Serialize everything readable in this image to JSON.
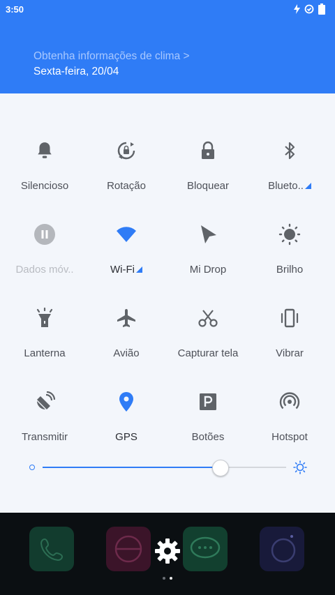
{
  "status_bar": {
    "time": "3:50"
  },
  "header": {
    "weather_link": "Obtenha informações de clima >",
    "date": "Sexta-feira, 20/04"
  },
  "tiles": [
    {
      "label": "Silencioso",
      "icon": "bell-icon"
    },
    {
      "label": "Rotação",
      "icon": "rotation-lock-icon"
    },
    {
      "label": "Bloquear",
      "icon": "lock-icon"
    },
    {
      "label": "Blueto..",
      "icon": "bluetooth-icon"
    },
    {
      "label": "Dados móv..",
      "icon": "mobile-data-icon"
    },
    {
      "label": "Wi-Fi",
      "icon": "wifi-icon"
    },
    {
      "label": "Mi Drop",
      "icon": "mi-drop-icon"
    },
    {
      "label": "Brilho",
      "icon": "brightness-icon"
    },
    {
      "label": "Lanterna",
      "icon": "flashlight-icon"
    },
    {
      "label": "Avião",
      "icon": "airplane-icon"
    },
    {
      "label": "Capturar tela",
      "icon": "scissors-icon"
    },
    {
      "label": "Vibrar",
      "icon": "vibrate-icon"
    },
    {
      "label": "Transmitir",
      "icon": "cast-icon"
    },
    {
      "label": "GPS",
      "icon": "location-pin-icon"
    },
    {
      "label": "Botões",
      "icon": "parking-icon"
    },
    {
      "label": "Hotspot",
      "icon": "hotspot-icon"
    }
  ],
  "brightness": {
    "level_fraction": 0.73
  },
  "colors": {
    "accent": "#2f7cf6",
    "panel": "#f3f6fb",
    "icon": "#5f6368"
  }
}
